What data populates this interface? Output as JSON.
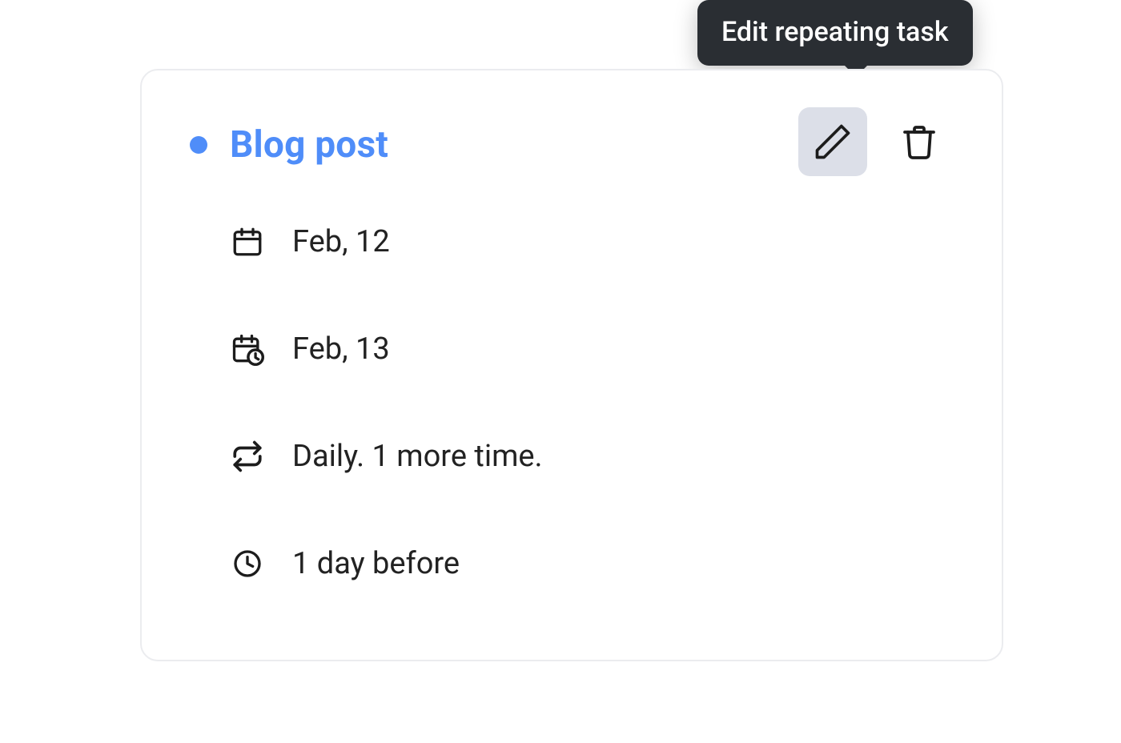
{
  "tooltip": {
    "text": "Edit repeating task"
  },
  "task": {
    "title": "Blog post",
    "start_date": "Feb, 12",
    "due_date": "Feb, 13",
    "repeat": "Daily. 1 more time.",
    "reminder": "1 day before"
  },
  "colors": {
    "accent": "#4f8df9",
    "tooltip_bg": "#2a2e33",
    "icon_active_bg": "#dcdfe8"
  }
}
